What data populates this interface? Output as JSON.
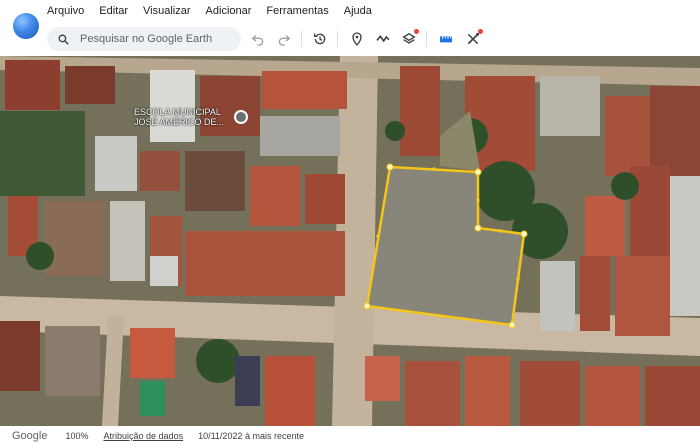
{
  "menu": {
    "items": [
      {
        "label": "Arquivo"
      },
      {
        "label": "Editar"
      },
      {
        "label": "Visualizar"
      },
      {
        "label": "Adicionar"
      },
      {
        "label": "Ferramentas"
      },
      {
        "label": "Ajuda"
      }
    ]
  },
  "search": {
    "placeholder": "Pesquisar no Google Earth"
  },
  "toolbar": {
    "icons": [
      "undo-icon",
      "redo-icon",
      "history-icon",
      "placemark-icon",
      "path-icon",
      "layers-icon",
      "ruler-icon",
      "measure-icon"
    ]
  },
  "map": {
    "poi_line1": "Escola Municipal",
    "poi_line2": "José Américo de...",
    "polygon_color": "#f5c518"
  },
  "status": {
    "logo": "Google",
    "zoom": "100%",
    "attribution": "Atribuição de dados",
    "imagery_date": "10/11/2022 à mais recente"
  },
  "colors": {
    "accent": "#1a73e8",
    "polygon": "#f5c518"
  }
}
